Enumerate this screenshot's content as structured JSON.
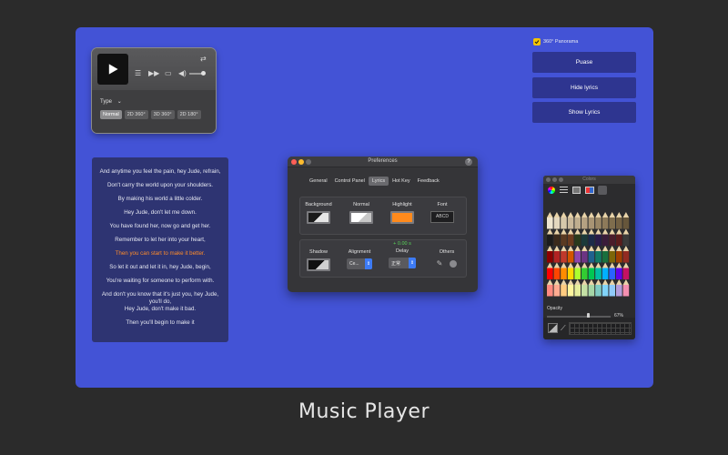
{
  "caption": "Music Player",
  "player": {
    "type_label": "Type",
    "type_chevron": "⌄",
    "types": [
      "Normal",
      "2D 360°",
      "3D 360°",
      "2D 180°"
    ],
    "active_type": 0,
    "icons": [
      "play-icon",
      "playlist-icon",
      "next-icon",
      "folder-icon",
      "volume-icon",
      "swap-icon"
    ]
  },
  "lyrics": {
    "lines": [
      "And anytime you feel the pain, hey Jude, refrain,",
      "Don't carry the world upon your shoulders.",
      "By making his world a little colder.",
      "Hey Jude, don't let me down.",
      "You have found her, now go and get her.",
      "Remember to let her into your heart,",
      "Then you can start to make it better.",
      "So let it out and let it in, hey Jude, begin,",
      "You're waiting for someone to perform with.",
      "And don't you know that it's just you, hey Jude, you'll do,",
      "Hey Jude, don't make it bad.",
      "Then you'll begin to make it"
    ],
    "active_index": 6,
    "active_color": "#ff8c2a"
  },
  "right_panel": {
    "panorama_label": "360° Panorama",
    "buttons": [
      "Puase",
      "Hide lyrics",
      "Show Lyrics"
    ]
  },
  "preferences": {
    "title": "Preferences",
    "help": "?",
    "tabs": [
      "General",
      "Control Panel",
      "Lyrics",
      "Hot Key",
      "Feedback"
    ],
    "active_tab": 2,
    "row1": {
      "background_label": "Background",
      "normal_label": "Normal",
      "highlight_label": "Highlight",
      "font_label": "Font",
      "font_value": "ABCD",
      "highlight_color": "#ff8a1c"
    },
    "row2": {
      "shadow_label": "Shadow",
      "alignment_label": "Alignment",
      "alignment_value": "Ce...",
      "delay_value": "+ 0.00 s",
      "delay_label": "Delay",
      "delay_select": "正常",
      "others_label": "Others"
    }
  },
  "colors_panel": {
    "title": "Colors",
    "opacity_label": "Opacity",
    "opacity_value": "67%",
    "opacity": 0.67
  }
}
